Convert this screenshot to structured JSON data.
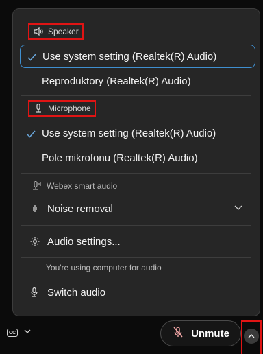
{
  "speaker": {
    "header": "Speaker",
    "options": [
      {
        "label": "Use system setting (Realtek(R) Audio)",
        "selected": true
      },
      {
        "label": "Reproduktory (Realtek(R) Audio)",
        "selected": false
      }
    ]
  },
  "microphone": {
    "header": "Microphone",
    "options": [
      {
        "label": "Use system setting (Realtek(R) Audio)",
        "selected": true
      },
      {
        "label": "Pole mikrofonu (Realtek(R) Audio)",
        "selected": false
      }
    ]
  },
  "smart_audio": {
    "header": "Webex smart audio",
    "noise_label": "Noise removal"
  },
  "audio_settings_label": "Audio settings...",
  "info_text": "You're using computer for audio",
  "switch_audio_label": "Switch audio",
  "footer": {
    "unmute_label": "Unmute"
  },
  "colors": {
    "accent": "#3f8fd0",
    "highlight_box": "#e01414",
    "panel_bg": "#262626"
  }
}
